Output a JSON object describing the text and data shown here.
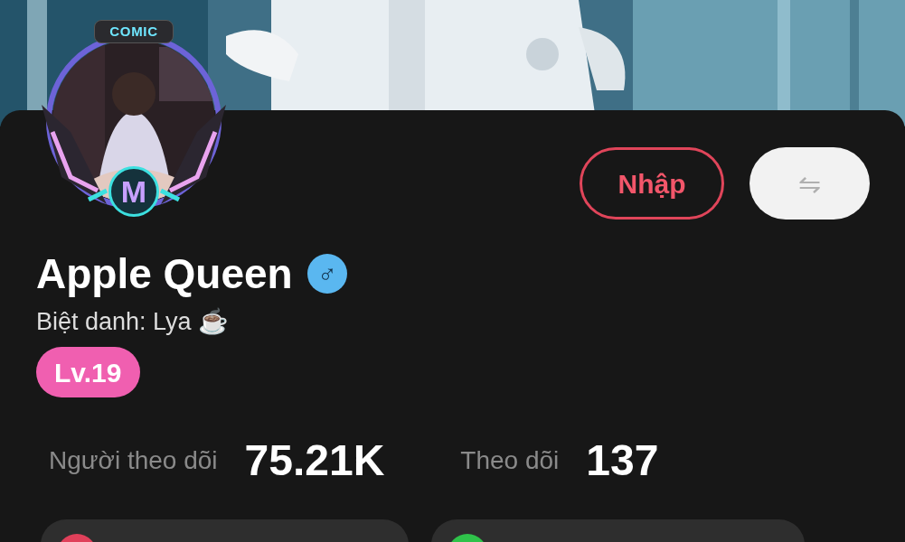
{
  "avatar": {
    "frame_label": "COMIC",
    "frame_badge": "M"
  },
  "buttons": [
    {
      "kind": "outline",
      "label": "Nhập"
    },
    {
      "kind": "filled",
      "label": "⇋"
    }
  ],
  "profile": {
    "name": "Apple Queen",
    "gender_symbol": "♂",
    "nickname": "Biệt danh: Lya ☕",
    "level": "Lv.19"
  },
  "stats": [
    {
      "label": "Người theo dõi",
      "value": "75.21K"
    },
    {
      "label": "Theo dõi",
      "value": "137"
    }
  ],
  "cards": [
    {
      "color": "#e0405a"
    },
    {
      "color": "#2fc24a"
    }
  ]
}
